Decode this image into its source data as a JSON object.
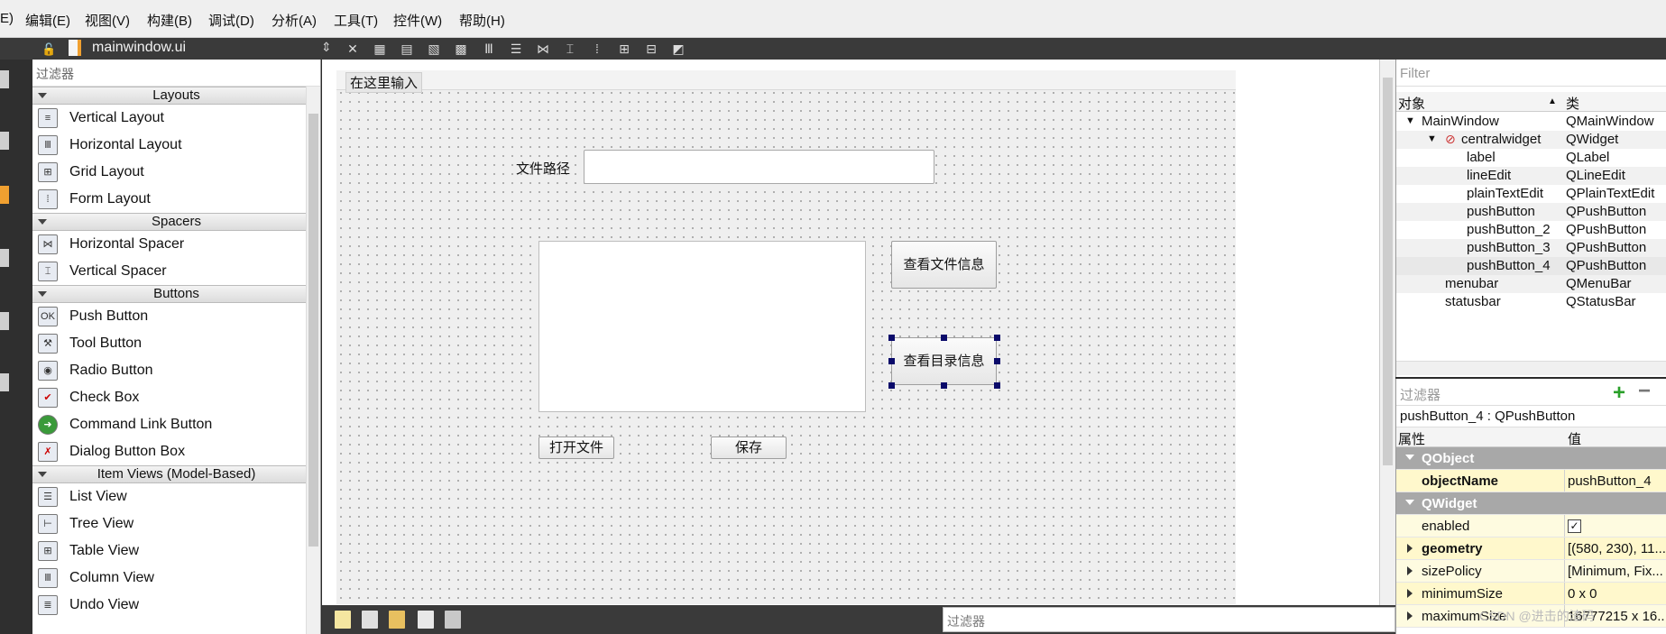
{
  "menu": [
    "E)",
    "编辑(E)",
    "视图(V)",
    "构建(B)",
    "调试(D)",
    "分析(A)",
    "工具(T)",
    "控件(W)",
    "帮助(H)"
  ],
  "file_tab": {
    "name": "mainwindow.ui",
    "arrows": "⇕"
  },
  "widget_box": {
    "filter_placeholder": "过滤器",
    "sections": [
      {
        "title": "Layouts",
        "items": [
          "Vertical Layout",
          "Horizontal Layout",
          "Grid Layout",
          "Form Layout"
        ],
        "icons": [
          "vertical-layout-icon",
          "horizontal-layout-icon",
          "grid-layout-icon",
          "form-layout-icon"
        ]
      },
      {
        "title": "Spacers",
        "items": [
          "Horizontal Spacer",
          "Vertical Spacer"
        ],
        "icons": [
          "horizontal-spacer-icon",
          "vertical-spacer-icon"
        ]
      },
      {
        "title": "Buttons",
        "items": [
          "Push Button",
          "Tool Button",
          "Radio Button",
          "Check Box",
          "Command Link Button",
          "Dialog Button Box"
        ],
        "icons": [
          "push-button-icon",
          "tool-button-icon",
          "radio-button-icon",
          "check-box-icon",
          "command-link-icon",
          "dialog-button-box-icon"
        ]
      },
      {
        "title": "Item Views (Model-Based)",
        "items": [
          "List View",
          "Tree View",
          "Table View",
          "Column View",
          "Undo View"
        ],
        "icons": [
          "list-view-icon",
          "tree-view-icon",
          "table-view-icon",
          "column-view-icon",
          "undo-view-icon"
        ]
      }
    ]
  },
  "form": {
    "menu_placeholder": "在这里输入",
    "label": "文件路径",
    "btn_view_file": "查看文件信息",
    "btn_view_dir": "查看目录信息",
    "btn_open": "打开文件",
    "btn_save": "保存"
  },
  "bottom_filter": "过滤器",
  "object_inspector": {
    "filter_placeholder": "Filter",
    "col_object": "对象",
    "col_class": "类",
    "rows": [
      {
        "name": "MainWindow",
        "cls": "QMainWindow"
      },
      {
        "name": "centralwidget",
        "cls": "QWidget"
      },
      {
        "name": "label",
        "cls": "QLabel"
      },
      {
        "name": "lineEdit",
        "cls": "QLineEdit"
      },
      {
        "name": "plainTextEdit",
        "cls": "QPlainTextEdit"
      },
      {
        "name": "pushButton",
        "cls": "QPushButton"
      },
      {
        "name": "pushButton_2",
        "cls": "QPushButton"
      },
      {
        "name": "pushButton_3",
        "cls": "QPushButton"
      },
      {
        "name": "pushButton_4",
        "cls": "QPushButton"
      },
      {
        "name": "menubar",
        "cls": "QMenuBar"
      },
      {
        "name": "statusbar",
        "cls": "QStatusBar"
      }
    ]
  },
  "property_editor": {
    "filter_placeholder": "过滤器",
    "object_line": "pushButton_4 : QPushButton",
    "col_property": "属性",
    "col_value": "值",
    "group_qobject": "QObject",
    "object_name_label": "objectName",
    "object_name_value": "pushButton_4",
    "group_qwidget": "QWidget",
    "enabled_label": "enabled",
    "enabled_value": "✓",
    "geometry_label": "geometry",
    "geometry_value": "[(580, 230), 11...",
    "size_policy_label": "sizePolicy",
    "size_policy_value": "[Minimum, Fix...",
    "min_size_label": "minimumSize",
    "min_size_value": "0 x 0",
    "max_size_label": "maximumSize",
    "max_size_value": "16777215 x 16..."
  },
  "watermark": "CSDN @进击的渣码"
}
